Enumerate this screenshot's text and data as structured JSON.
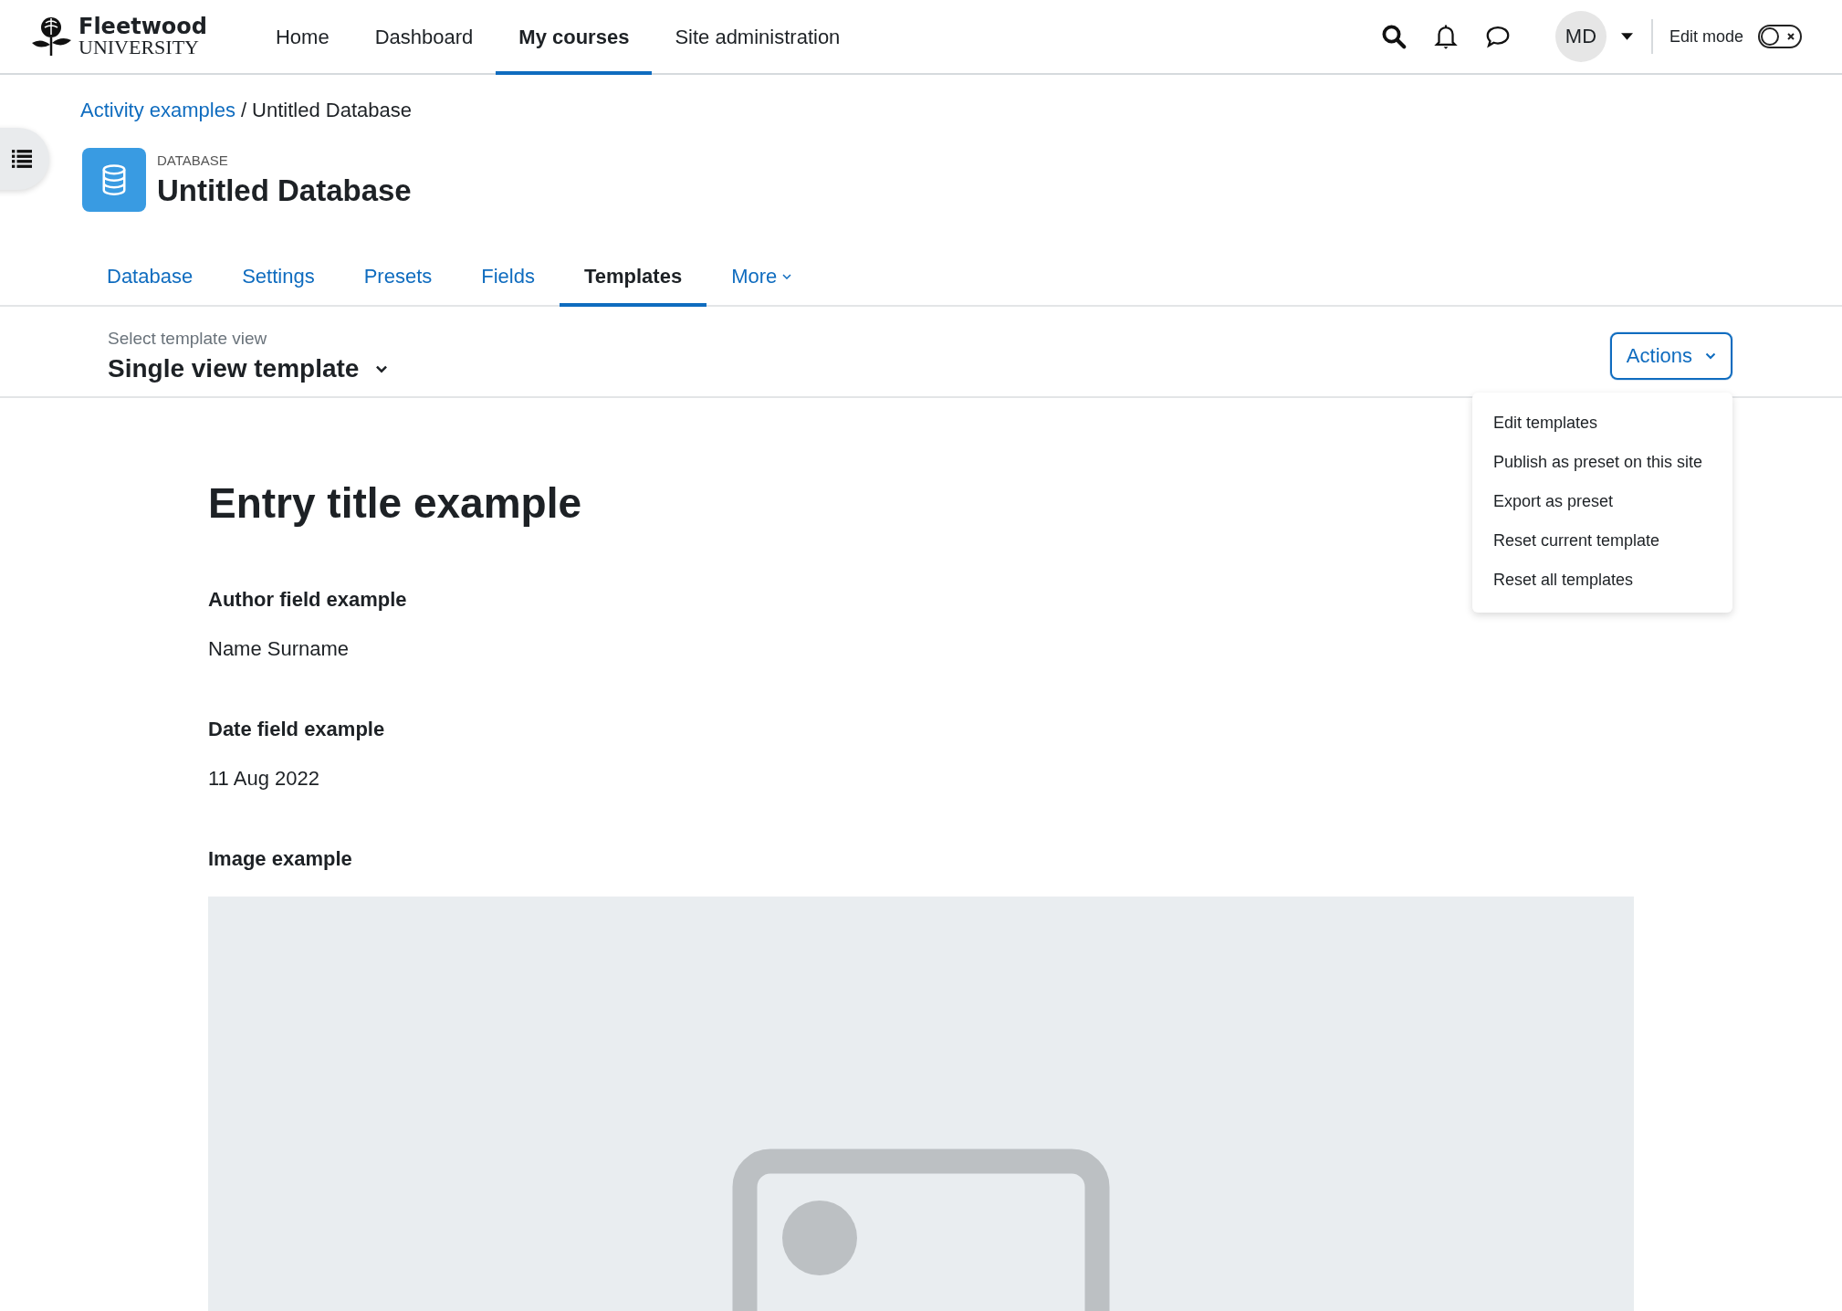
{
  "header": {
    "logo": {
      "name": "Fleetwood",
      "subtitle": "UNIVERSITY"
    },
    "nav": [
      {
        "label": "Home",
        "selected": false
      },
      {
        "label": "Dashboard",
        "selected": false
      },
      {
        "label": "My courses",
        "selected": true
      },
      {
        "label": "Site administration",
        "selected": false
      }
    ],
    "user_initials": "MD",
    "edit_mode": {
      "label": "Edit mode",
      "on": false
    }
  },
  "breadcrumb": {
    "items": [
      {
        "label": "Activity examples",
        "kind": "link"
      },
      {
        "label": "Untitled Database",
        "kind": "current"
      }
    ],
    "separator": "/"
  },
  "activity": {
    "type_label": "DATABASE",
    "title": "Untitled Database"
  },
  "tabs": [
    {
      "label": "Database",
      "selected": false,
      "kind": "tab"
    },
    {
      "label": "Settings",
      "selected": false,
      "kind": "tab"
    },
    {
      "label": "Presets",
      "selected": false,
      "kind": "tab"
    },
    {
      "label": "Fields",
      "selected": false,
      "kind": "tab"
    },
    {
      "label": "Templates",
      "selected": true,
      "kind": "tab"
    },
    {
      "label": "More",
      "selected": false,
      "kind": "menu"
    }
  ],
  "template_view": {
    "label": "Select template view",
    "value": "Single view template"
  },
  "actions": {
    "label": "Actions",
    "expanded": true,
    "items": [
      "Edit templates",
      "Publish as preset on this site",
      "Export as preset",
      "Reset current template",
      "Reset all templates"
    ]
  },
  "entry": {
    "title": "Entry title example",
    "fields": [
      {
        "label": "Author field example",
        "kind": "text",
        "value": "Name Surname"
      },
      {
        "label": "Date field example",
        "kind": "text",
        "value": "11 Aug 2022"
      },
      {
        "label": "Image example",
        "kind": "image"
      }
    ]
  }
}
